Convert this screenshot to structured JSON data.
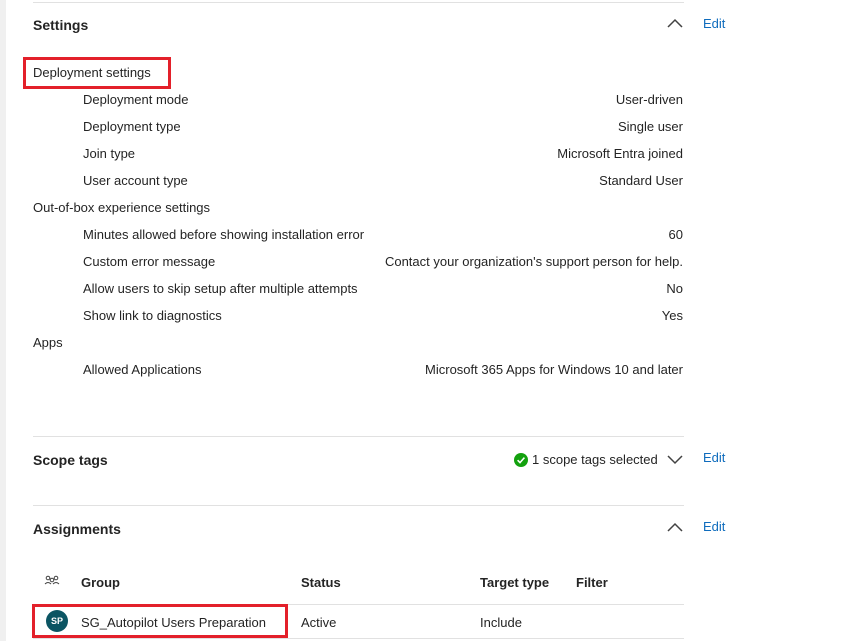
{
  "settings": {
    "title": "Settings",
    "edit_label": "Edit",
    "groups": [
      {
        "label": "Deployment settings",
        "rows": [
          {
            "label": "Deployment mode",
            "value": "User-driven"
          },
          {
            "label": "Deployment type",
            "value": "Single user"
          },
          {
            "label": "Join type",
            "value": "Microsoft Entra joined"
          },
          {
            "label": "User account type",
            "value": "Standard User"
          }
        ]
      },
      {
        "label": "Out-of-box experience settings",
        "rows": [
          {
            "label": "Minutes allowed before showing installation error",
            "value": "60"
          },
          {
            "label": "Custom error message",
            "value": "Contact your organization's support person for help."
          },
          {
            "label": "Allow users to skip setup after multiple attempts",
            "value": "No"
          },
          {
            "label": "Show link to diagnostics",
            "value": "Yes"
          }
        ]
      },
      {
        "label": "Apps",
        "rows": [
          {
            "label": "Allowed Applications",
            "value": "Microsoft 365 Apps for Windows 10 and later"
          }
        ]
      }
    ]
  },
  "scope_tags": {
    "title": "Scope tags",
    "summary": "1 scope tags selected",
    "edit_label": "Edit",
    "status_color": "#13a10e"
  },
  "assignments": {
    "title": "Assignments",
    "edit_label": "Edit",
    "columns": {
      "group": "Group",
      "status": "Status",
      "target_type": "Target type",
      "filter": "Filter"
    },
    "rows": [
      {
        "avatar": "SP",
        "group": "SG_Autopilot Users Preparation",
        "status": "Active",
        "target_type": "Include",
        "filter": ""
      }
    ]
  },
  "colors": {
    "accent_link": "#0f6cbd",
    "highlight_border": "#e3202a",
    "avatar_bg": "#0b5563"
  },
  "icons": {
    "collapse": "chevron-up-icon",
    "expand": "chevron-down-icon",
    "group_header": "group-icon",
    "status_ok": "checkmark-circle-icon"
  }
}
